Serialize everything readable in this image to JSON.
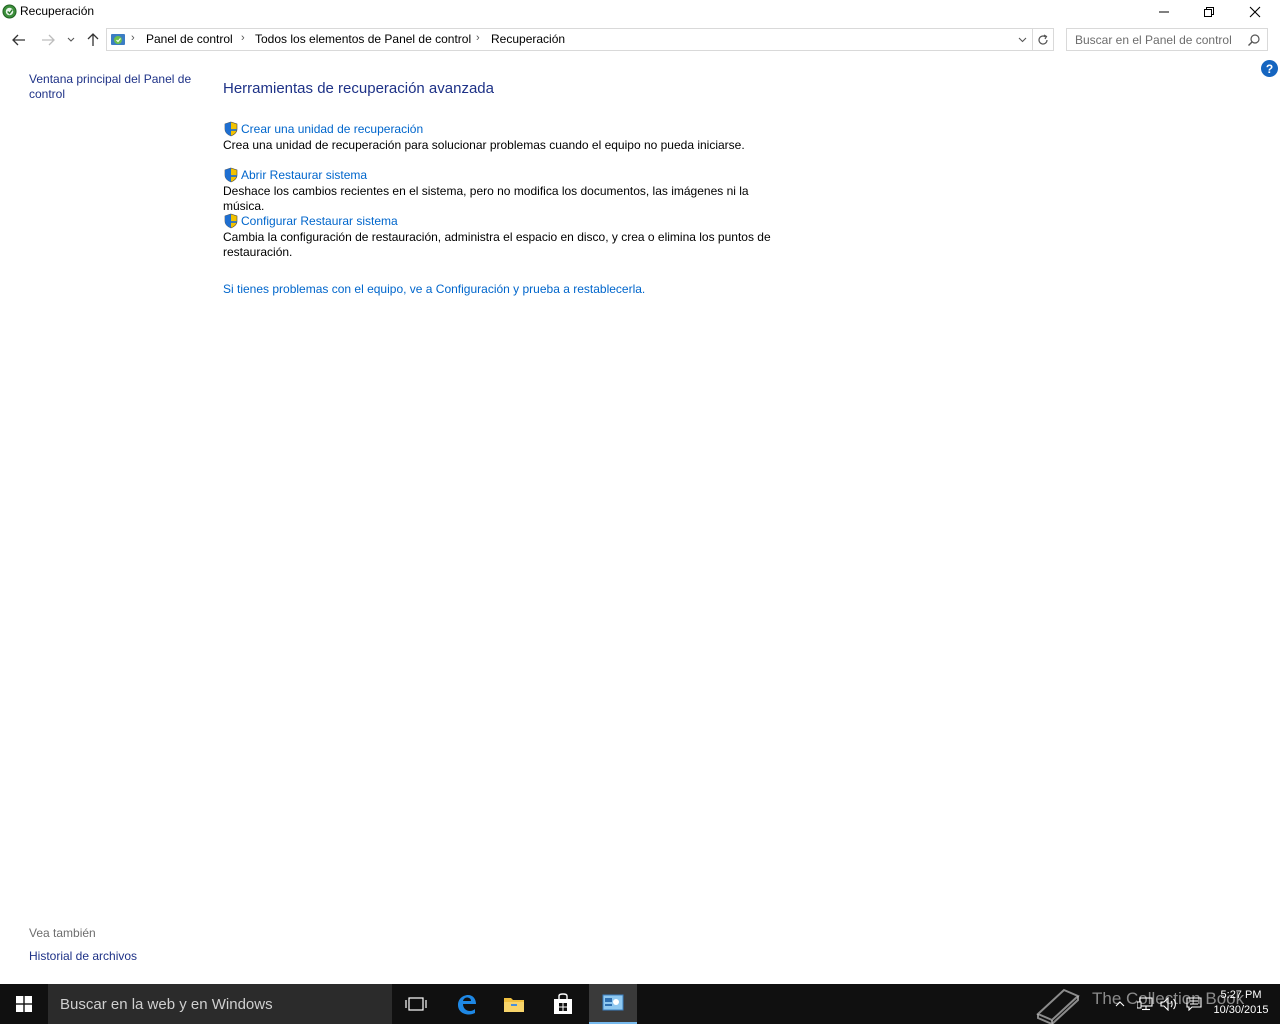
{
  "window": {
    "title": "Recuperación",
    "icon": "recovery-icon"
  },
  "nav": {
    "breadcrumbs": [
      "Panel de control",
      "Todos los elementos de Panel de control",
      "Recuperación"
    ],
    "search_placeholder": "Buscar en el Panel de control"
  },
  "leftpane": {
    "home_link": "Ventana principal del Panel de control",
    "see_also_heading": "Vea también",
    "see_also_link": "Historial de archivos"
  },
  "main": {
    "title": "Herramientas de recuperación avanzada",
    "tasks": [
      {
        "label": "Crear una unidad de recuperación",
        "description": "Crea una unidad de recuperación para solucionar problemas cuando el equipo no pueda iniciarse."
      },
      {
        "label": "Abrir Restaurar sistema",
        "description": "Deshace los cambios recientes en el sistema, pero no modifica los documentos, las imágenes ni la música."
      },
      {
        "label": "Configurar Restaurar sistema",
        "description": "Cambia la configuración de restauración, administra el espacio en disco, y crea o elimina los puntos de restauración."
      }
    ],
    "reset_link": "Si tienes problemas con el equipo, ve a Configuración y prueba a restablecerla."
  },
  "taskbar": {
    "search_text": "Buscar en la web y en Windows",
    "time": "5:27 PM",
    "date": "10/30/2015",
    "watermark": "The Collection Book"
  },
  "colors": {
    "link": "#0066cc",
    "heading": "#1e3287",
    "taskbar": "#101010"
  }
}
